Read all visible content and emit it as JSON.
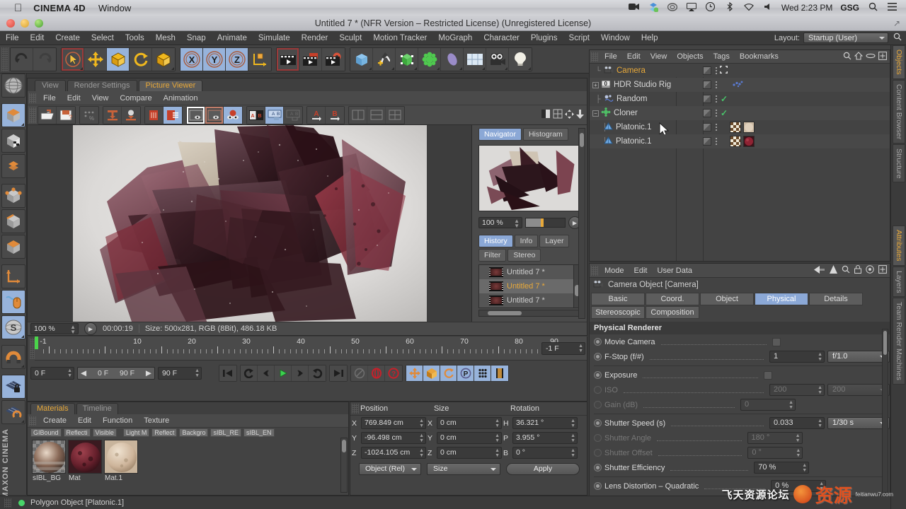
{
  "macbar": {
    "apple_icon": "apple-icon",
    "app_name": "CINEMA 4D",
    "window_menu": "Window",
    "clock": "Wed 2:23 PM",
    "gsg": "GSG",
    "icons": [
      "screen-record-icon",
      "dropbox-icon",
      "creative-cloud-icon",
      "airplay-icon",
      "time-machine-icon",
      "bluetooth-icon",
      "wifi-icon",
      "volume-icon"
    ],
    "search_icon": "search-icon",
    "list_icon": "notification-center-icon"
  },
  "window": {
    "title": "Untitled 7 * (NFR Version – Restricted License) (Unregistered License)",
    "expand_icon": "fullscreen-icon"
  },
  "mainmenu": {
    "items": [
      "File",
      "Edit",
      "Create",
      "Select",
      "Tools",
      "Mesh",
      "Snap",
      "Animate",
      "Simulate",
      "Render",
      "Sculpt",
      "Motion Tracker",
      "MoGraph",
      "Character",
      "Plugins",
      "Script",
      "Window",
      "Help"
    ],
    "layout_label": "Layout:",
    "layout_value": "Startup (User)",
    "search_icon": "search-icon"
  },
  "toolbar": {
    "groups": [
      {
        "name": "undo-redo",
        "buttons": [
          {
            "name": "undo-button",
            "icon": "undo-arrow-icon",
            "state": "normal"
          },
          {
            "name": "redo-button",
            "icon": "redo-arrow-icon",
            "state": "disabled"
          }
        ]
      },
      {
        "name": "transform-tools",
        "buttons": [
          {
            "name": "live-selection-tool",
            "icon": "cursor-circle-icon",
            "state": "selected"
          },
          {
            "name": "move-tool",
            "icon": "move-cross-icon",
            "state": "normal"
          },
          {
            "name": "scale-tool",
            "icon": "scale-box-icon",
            "state": "active"
          },
          {
            "name": "rotate-tool",
            "icon": "rotate-arc-icon",
            "state": "normal"
          },
          {
            "name": "free-scale-tool",
            "icon": "scale-box-icon",
            "state": "normal"
          }
        ]
      },
      {
        "name": "axis-locks",
        "buttons": [
          {
            "name": "lock-x-axis",
            "icon": "x-axis-icon",
            "state": "active"
          },
          {
            "name": "lock-y-axis",
            "icon": "y-axis-icon",
            "state": "active"
          },
          {
            "name": "lock-z-axis",
            "icon": "z-axis-icon",
            "state": "active"
          },
          {
            "name": "world-object-coordinate-toggle",
            "icon": "coordinate-cube-icon",
            "state": "normal"
          }
        ]
      },
      {
        "name": "render-tools",
        "buttons": [
          {
            "name": "render-view-button",
            "icon": "clapperboard-icon",
            "state": "selected"
          },
          {
            "name": "render-region-button",
            "icon": "clapperboard-region-icon",
            "state": "normal"
          },
          {
            "name": "render-settings-button",
            "icon": "clapperboard-gear-icon",
            "state": "normal"
          }
        ]
      },
      {
        "name": "create-objects",
        "buttons": [
          {
            "name": "add-cube-button",
            "icon": "cube-icon",
            "state": "normal"
          },
          {
            "name": "add-spline-button",
            "icon": "pen-spline-icon",
            "state": "normal"
          },
          {
            "name": "add-nurbs-button",
            "icon": "green-nurbs-icon",
            "state": "normal"
          },
          {
            "name": "add-array-button",
            "icon": "green-array-icon",
            "state": "normal"
          },
          {
            "name": "add-deformer-button",
            "icon": "bend-deformer-icon",
            "state": "normal"
          },
          {
            "name": "add-environment-button",
            "icon": "floor-grid-icon",
            "state": "normal"
          },
          {
            "name": "add-camera-button",
            "icon": "camera-icon",
            "state": "normal"
          },
          {
            "name": "add-light-button",
            "icon": "lightbulb-icon",
            "state": "normal"
          }
        ]
      }
    ]
  },
  "leftbar": {
    "buttons": [
      {
        "name": "make-editable-button",
        "icon": "globe-wire-icon",
        "state": "normal"
      },
      {
        "name": "model-mode-button",
        "icon": "model-cube-icon",
        "state": "active"
      },
      {
        "name": "texture-mode-button",
        "icon": "texture-cube-icon",
        "state": "normal"
      },
      {
        "name": "uv-mesh-button",
        "icon": "uv-grid-icon",
        "state": "normal"
      },
      {
        "name": "points-mode-button",
        "icon": "points-cube-icon",
        "state": "normal"
      },
      {
        "name": "edges-mode-button",
        "icon": "edges-cube-icon",
        "state": "normal"
      },
      {
        "name": "polygons-mode-button",
        "icon": "polygons-cube-icon",
        "state": "normal"
      },
      {
        "name": "axis-modify-button",
        "icon": "axis-corner-icon",
        "state": "normal"
      },
      {
        "name": "enable-snapping-button",
        "icon": "mouse-snap-icon",
        "state": "active"
      },
      {
        "name": "workplane-button",
        "icon": "s-disc-icon",
        "state": "active"
      },
      {
        "name": "magnet-tool-button",
        "icon": "magnet-icon",
        "state": "normal"
      },
      {
        "name": "lock-workplane-button",
        "icon": "grid-lock-icon",
        "state": "active"
      },
      {
        "name": "align-workplane-button",
        "icon": "grid-magnet-icon",
        "state": "normal"
      }
    ],
    "brand_line1": "MAXON",
    "brand_line2": "CINEMA"
  },
  "picture_viewer": {
    "tabs": [
      {
        "label": "View",
        "active": false
      },
      {
        "label": "Render Settings",
        "active": false
      },
      {
        "label": "Picture Viewer",
        "active": true
      }
    ],
    "menu": [
      "File",
      "Edit",
      "View",
      "Compare",
      "Animation"
    ],
    "tool_groups": [
      {
        "name": "file-tools",
        "buttons": [
          {
            "name": "open-image-button",
            "icon": "open-folder-icon"
          },
          {
            "name": "save-image-button",
            "icon": "save-disk-icon"
          }
        ]
      },
      {
        "name": "settings-tools",
        "buttons": [
          {
            "name": "render-settings-button",
            "icon": "settings-dots-icon"
          }
        ]
      },
      {
        "name": "send-tools",
        "buttons": [
          {
            "name": "send-to-button",
            "icon": "send-down-icon"
          },
          {
            "name": "send-object-button",
            "icon": "send-object-icon"
          }
        ]
      },
      {
        "name": "history-tools",
        "buttons": [
          {
            "name": "clear-history-button",
            "icon": "trash-book-icon"
          },
          {
            "name": "history-list-button",
            "icon": "history-book-icon",
            "state": "active"
          }
        ]
      },
      {
        "name": "view-tools",
        "buttons": [
          {
            "name": "fit-view-button",
            "icon": "fit-frame-icon",
            "state": "framed-white"
          },
          {
            "name": "zoom-view-button",
            "icon": "zoom-frame-icon",
            "state": "framed-red"
          },
          {
            "name": "color-channel-button",
            "icon": "rgb-eye-icon",
            "state": "active"
          }
        ]
      },
      {
        "name": "compare-tools",
        "buttons": [
          {
            "name": "ab-compare-button",
            "icon": "ab-compare-icon"
          },
          {
            "name": "ab-split-button",
            "icon": "ab-split-icon",
            "state": "active"
          },
          {
            "name": "ab-diff-button",
            "icon": "ab-diff-icon",
            "state": "disabled"
          }
        ]
      },
      {
        "name": "ab-assign-tools",
        "buttons": [
          {
            "name": "set-a-button",
            "icon": "a-arrow-icon"
          },
          {
            "name": "set-b-button",
            "icon": "b-arrow-icon"
          }
        ]
      },
      {
        "name": "layout-tools",
        "buttons": [
          {
            "name": "layout-single-button",
            "icon": "layout-single-icon"
          },
          {
            "name": "layout-split-button",
            "icon": "layout-split-icon"
          },
          {
            "name": "layout-quad-button",
            "icon": "layout-quad-icon"
          }
        ]
      }
    ],
    "right_tools": [
      {
        "name": "histogram-toggle-button",
        "icon": "half-tone-icon"
      },
      {
        "name": "grid-overlay-button",
        "icon": "grid-square-icon"
      },
      {
        "name": "pan-tool-button",
        "icon": "pan-arrows-icon"
      },
      {
        "name": "move-down-button",
        "icon": "arrow-down-icon"
      }
    ],
    "status": {
      "zoom": "100 %",
      "play_icon": "play-icon",
      "timecode": "00:00:19",
      "info": "Size: 500x281, RGB (8Bit), 486.18 KB"
    },
    "side": {
      "tabs": [
        {
          "label": "Navigator",
          "active": true
        },
        {
          "label": "Histogram",
          "active": false
        }
      ],
      "zoom_value": "100 %",
      "zoom_play_icon": "play-icon",
      "lower_tabs": [
        {
          "label": "History",
          "active": true
        },
        {
          "label": "Info",
          "active": false
        },
        {
          "label": "Layer",
          "active": false
        },
        {
          "label": "Filter",
          "active": false
        },
        {
          "label": "Stereo",
          "active": false
        }
      ],
      "history": [
        {
          "label": "Untitled 7 *",
          "selected": false
        },
        {
          "label": "Untitled 7 *",
          "selected": true
        },
        {
          "label": "Untitled 7 *",
          "selected": false
        }
      ]
    }
  },
  "timeline": {
    "ruler_labels": [
      "-1",
      "10",
      "20",
      "30",
      "40",
      "50",
      "60",
      "70",
      "80",
      "90"
    ],
    "frame_field_right": "-1 F",
    "current_frame": "0 F",
    "range_start": "0 F",
    "range_end": "90 F",
    "max_frame": "90 F",
    "transport": [
      {
        "name": "go-to-start-button",
        "icon": "skip-start-icon"
      },
      {
        "name": "play-backwards-button",
        "icon": "rewind-loop-icon"
      },
      {
        "name": "previous-key-button",
        "icon": "prev-key-icon"
      },
      {
        "name": "play-button",
        "icon": "play-triangle-icon"
      },
      {
        "name": "next-key-button",
        "icon": "next-key-icon"
      },
      {
        "name": "play-forward-loop-button",
        "icon": "forward-loop-icon"
      },
      {
        "name": "go-to-end-button",
        "icon": "skip-end-icon"
      }
    ],
    "record_tools": [
      {
        "name": "autokey-button",
        "icon": "autokey-circle-icon",
        "state": "disabled"
      },
      {
        "name": "record-active-objects-button",
        "icon": "record-red-icon"
      },
      {
        "name": "add-keyframe-button",
        "icon": "question-red-icon"
      }
    ],
    "key_tools": [
      {
        "name": "key-position-button",
        "icon": "move-cross-icon",
        "state": "active"
      },
      {
        "name": "key-scale-button",
        "icon": "scale-box-icon",
        "state": "active"
      },
      {
        "name": "key-rotation-button",
        "icon": "rotate-arc-icon",
        "state": "active"
      },
      {
        "name": "key-param-button",
        "icon": "p-circle-icon",
        "state": "active"
      },
      {
        "name": "key-pla-button",
        "icon": "dots-grid-icon",
        "state": "active"
      },
      {
        "name": "key-film-button",
        "icon": "film-strip-icon",
        "state": "active"
      }
    ]
  },
  "materials": {
    "tabs": [
      {
        "label": "Materials",
        "active": true
      },
      {
        "label": "Timeline",
        "active": false
      }
    ],
    "menu": [
      "Create",
      "Edit",
      "Function",
      "Texture"
    ],
    "chips": [
      "GIBound",
      "Reflecti",
      "Visible",
      "Light M",
      "Reflect",
      "Backgro",
      "sIBL_RE",
      "sIBL_EN"
    ],
    "items": [
      {
        "name": "sIBL_BG",
        "selected": false,
        "swatch": "hdri-sphere"
      },
      {
        "name": "Mat",
        "selected": true,
        "swatch": "dark-red-sphere"
      },
      {
        "name": "Mat.1",
        "selected": false,
        "swatch": "beige-sphere"
      }
    ]
  },
  "coordinates": {
    "headers": [
      "Position",
      "Size",
      "Rotation"
    ],
    "rows": [
      {
        "axis_pos": "X",
        "pos": "769.849 cm",
        "axis_size": "X",
        "size": "0 cm",
        "axis_rot": "H",
        "rot": "36.321 °"
      },
      {
        "axis_pos": "Y",
        "pos": "-96.498 cm",
        "axis_size": "Y",
        "size": "0 cm",
        "axis_rot": "P",
        "rot": "3.955 °"
      },
      {
        "axis_pos": "Z",
        "pos": "-1024.105 cm",
        "axis_size": "Z",
        "size": "0 cm",
        "axis_rot": "B",
        "rot": "0 °"
      }
    ],
    "mode_dropdown": "Object (Rel)",
    "size_dropdown": "Size",
    "apply_button": "Apply"
  },
  "object_manager": {
    "menu": [
      "File",
      "Edit",
      "View",
      "Objects",
      "Tags",
      "Bookmarks"
    ],
    "icons": [
      "search-icon",
      "home-icon",
      "ellipse-icon",
      "add-layer-icon"
    ],
    "rows": [
      {
        "label": "Camera",
        "icon": "camera-object-icon",
        "depth": 1,
        "selected": true,
        "expander": null,
        "check": false,
        "tag_icon": "axis-move-icon",
        "tags": []
      },
      {
        "label": "HDR Studio Rig",
        "icon": "null-object-icon",
        "depth": 0,
        "selected": false,
        "expander": "+",
        "check": false,
        "tag_icon": "dots-blue-icon",
        "tags": []
      },
      {
        "label": "Random",
        "icon": "random-effector-icon",
        "depth": 1,
        "selected": false,
        "expander": null,
        "check": true,
        "tags": []
      },
      {
        "label": "Cloner",
        "icon": "cloner-icon",
        "depth": 0,
        "selected": false,
        "expander": "-",
        "check": true,
        "tags": []
      },
      {
        "label": "Platonic.1",
        "icon": "platonic-icon",
        "depth": 2,
        "selected": false,
        "expander": null,
        "check": false,
        "tags": [
          "checker-tag",
          "beige-material-tag"
        ]
      },
      {
        "label": "Platonic.1",
        "icon": "platonic-icon",
        "depth": 2,
        "selected": false,
        "expander": null,
        "check": false,
        "tags": [
          "checker-tag",
          "red-material-tag"
        ]
      }
    ]
  },
  "attributes": {
    "menu": [
      "Mode",
      "Edit",
      "User Data"
    ],
    "icons": [
      "back-arrow-icon",
      "up-arrow-icon",
      "search-icon",
      "lock-icon",
      "target-icon",
      "add-icon"
    ],
    "object_title": "Camera Object [Camera]",
    "object_icon": "camera-object-icon",
    "tabs_row1": [
      {
        "label": "Basic",
        "active": false
      },
      {
        "label": "Coord.",
        "active": false
      },
      {
        "label": "Object",
        "active": false
      },
      {
        "label": "Physical",
        "active": true
      },
      {
        "label": "Details",
        "active": false
      }
    ],
    "tabs_row2": [
      {
        "label": "Stereoscopic",
        "active": false
      },
      {
        "label": "Composition",
        "active": false
      }
    ],
    "section_title": "Physical Renderer",
    "properties": [
      {
        "name": "movie-camera",
        "label": "Movie Camera",
        "type": "checkbox",
        "value": "",
        "radio": "on",
        "dim": false
      },
      {
        "name": "f-stop",
        "label": "F-Stop (f/#)",
        "type": "field-dropdown",
        "value": "1",
        "dropdown": "f/1.0",
        "radio": "on",
        "dim": false
      },
      {
        "name": "exposure",
        "label": "Exposure",
        "type": "checkbox",
        "value": "",
        "radio": "on",
        "dim": false
      },
      {
        "name": "iso",
        "label": "ISO",
        "type": "field-dropdown",
        "value": "200",
        "dropdown": "200",
        "radio": "off",
        "dim": true
      },
      {
        "name": "gain-db",
        "label": "Gain (dB)",
        "type": "field",
        "value": "0",
        "radio": "off",
        "dim": true
      },
      {
        "name": "shutter-speed",
        "label": "Shutter Speed (s)",
        "type": "field-dropdown",
        "value": "0.033",
        "dropdown": "1/30 s",
        "radio": "on",
        "dim": false
      },
      {
        "name": "shutter-angle",
        "label": "Shutter Angle",
        "type": "field",
        "value": "180 °",
        "radio": "off",
        "dim": true
      },
      {
        "name": "shutter-offset",
        "label": "Shutter Offset",
        "type": "field",
        "value": "0 °",
        "radio": "off",
        "dim": true
      },
      {
        "name": "shutter-efficiency",
        "label": "Shutter Efficiency",
        "type": "field",
        "value": "70 %",
        "radio": "on",
        "dim": false
      },
      {
        "name": "lens-distortion-quadratic",
        "label": "Lens Distortion – Quadratic",
        "type": "field",
        "value": "0 %",
        "radio": "on",
        "dim": false
      }
    ]
  },
  "rail": {
    "top_tabs": [
      {
        "label": "Objects",
        "active": true
      },
      {
        "label": "Content Browser",
        "active": false
      },
      {
        "label": "Structure",
        "active": false
      }
    ],
    "bottom_tabs": [
      {
        "label": "Attributes",
        "active": true
      },
      {
        "label": "Layers",
        "active": false
      },
      {
        "label": "Team Render Machines",
        "active": false
      }
    ]
  },
  "statusbar": {
    "text": "Polygon Object [Platonic.1]",
    "indicator_color": "#49d469"
  },
  "watermark": {
    "cn_text": "飞天资源论坛",
    "big_text": "资源",
    "sub_text": "feitianwu7.com"
  },
  "colors": {
    "accent_orange": "#e8a93a",
    "active_blue": "#8ba8d6",
    "panel_bg": "#434343",
    "field_bg": "#3a3a3a",
    "check_green": "#49c46a"
  }
}
